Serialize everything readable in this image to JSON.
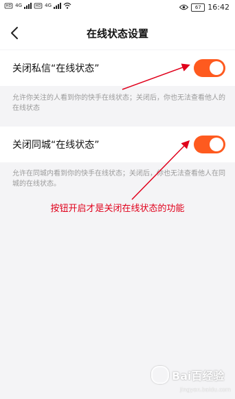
{
  "status_bar": {
    "sim1": "HD",
    "sim2": "HD",
    "net1": "4G",
    "net2": "4G",
    "battery": "67",
    "time": "16:42"
  },
  "header": {
    "title": "在线状态设置"
  },
  "settings": [
    {
      "label": "关闭私信“在线状态”",
      "enabled": true,
      "description": "允许你关注的人看到你的快手在线状态；关闭后，你也无法查看他人的在线状态"
    },
    {
      "label": "关闭同城“在线状态”",
      "enabled": true,
      "description": "允许在同城内看到你的快手在线状态；关闭后，你也无法查看他人在同城的在线状态。"
    }
  ],
  "annotation": "按钮开启才是关闭在线状态的功能",
  "watermark": {
    "text": "Bai百经验",
    "sub": "jingyan.baidu.com"
  },
  "colors": {
    "toggle_on": "#fe5a1f",
    "annotation": "#e0001b"
  }
}
